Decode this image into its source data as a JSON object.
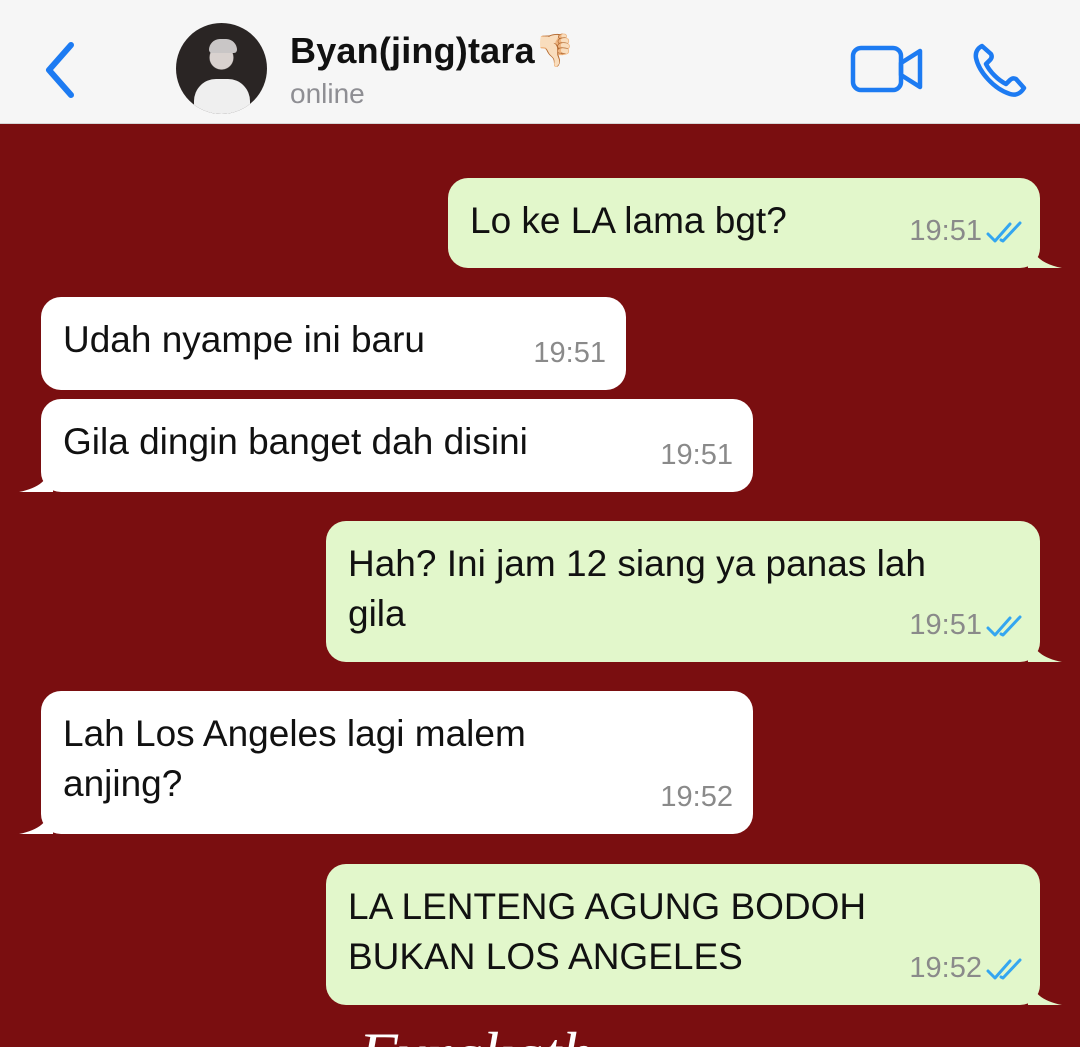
{
  "header": {
    "back_icon": "chevron-left-icon",
    "contact_name": "Byan(jing)tara",
    "name_emoji": "👎🏻",
    "status": "online",
    "video_icon": "video-camera-icon",
    "call_icon": "phone-icon",
    "accent_color": "#1d7bf2"
  },
  "colors": {
    "background": "#7a0e10",
    "sent_bubble": "#e2f7cb",
    "received_bubble": "#ffffff",
    "read_ticks": "#34a6f0"
  },
  "messages": [
    {
      "direction": "sent",
      "text": "Lo ke LA lama bgt?",
      "time": "19:51",
      "read": true
    },
    {
      "direction": "received",
      "text": "Udah nyampe ini baru",
      "time": "19:51"
    },
    {
      "direction": "received",
      "text": "Gila dingin banget dah disini",
      "time": "19:51"
    },
    {
      "direction": "sent",
      "text_line1": "Hah? Ini jam 12 siang ya panas lah",
      "text_line2": "gila",
      "time": "19:51",
      "read": true
    },
    {
      "direction": "received",
      "text_line1": "Lah Los Angeles lagi malem",
      "text_line2": "anjing?",
      "time": "19:52"
    },
    {
      "direction": "sent",
      "text_line1": "LA LENTENG AGUNG BODOH",
      "text_line2": "BUKAN LOS ANGELES",
      "time": "19:52",
      "read": true
    }
  ],
  "footer": {
    "partial_text": "Fyrakath ... ..."
  }
}
